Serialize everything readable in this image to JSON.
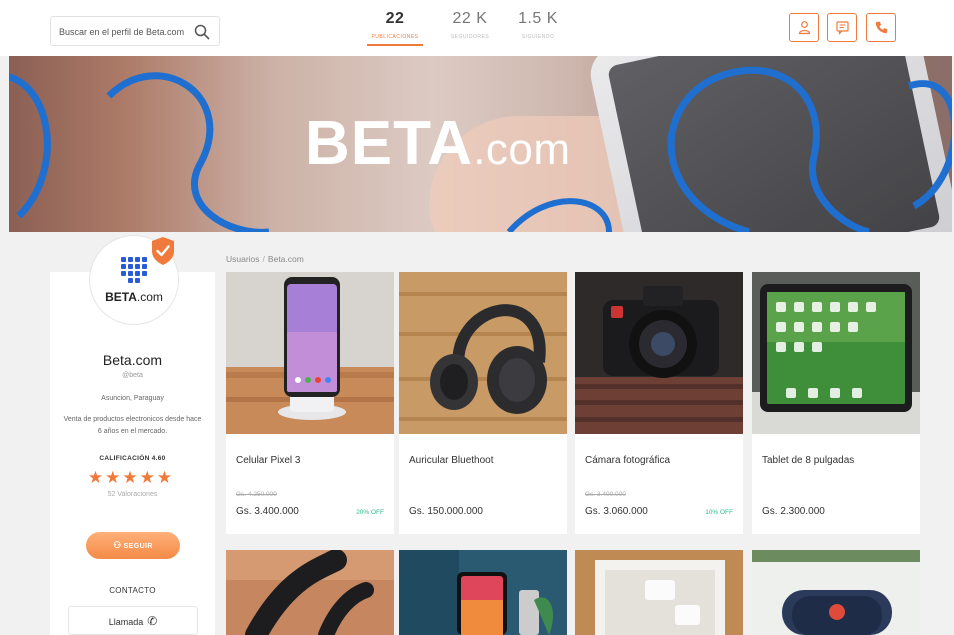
{
  "search": {
    "placeholder": "Buscar en el perfil de Beta.com"
  },
  "stats": [
    {
      "value": "22",
      "label": "PUBLICACIONES"
    },
    {
      "value": "22 K",
      "label": "SEGUIDORES"
    },
    {
      "value": "1.5 K",
      "label": "SIGUIENDO"
    }
  ],
  "banner": {
    "brand_main": "BETA",
    "brand_suffix": ".com"
  },
  "profile": {
    "logo_main": "BETA",
    "logo_suffix": ".com",
    "name": "Beta.com",
    "handle": "@beta",
    "location": "Asuncion, Paraguay",
    "description": "Venta de productos electronicos desde hace 6 años en el mercado.",
    "rating_label": "CALIFICACIÓN 4.60",
    "rating": 5,
    "reviews": "52 Valoraciones",
    "follow_label": "SEGUIR",
    "contact_title": "CONTACTO",
    "call_label": "Llamada"
  },
  "breadcrumb": [
    "Usuarios",
    "Beta.com"
  ],
  "products": [
    {
      "title": "Celular Pixel 3",
      "old_price": "Gs. 4.250.000",
      "price": "Gs. 3.400.000",
      "discount": "20% OFF"
    },
    {
      "title": "Auricular Bluethoot",
      "old_price": "",
      "price": "Gs. 150.000.000",
      "discount": ""
    },
    {
      "title": "Cámara fotográfica",
      "old_price": "Gs. 3.400.000",
      "price": "Gs. 3.060.000",
      "discount": "10% OFF"
    },
    {
      "title": "Tablet de 8 pulgadas",
      "old_price": "",
      "price": "Gs. 2.300.000",
      "discount": ""
    }
  ],
  "colors": {
    "accent": "#f07a3b",
    "discount": "#2bbf8e",
    "ring": "#1f6fd1"
  }
}
